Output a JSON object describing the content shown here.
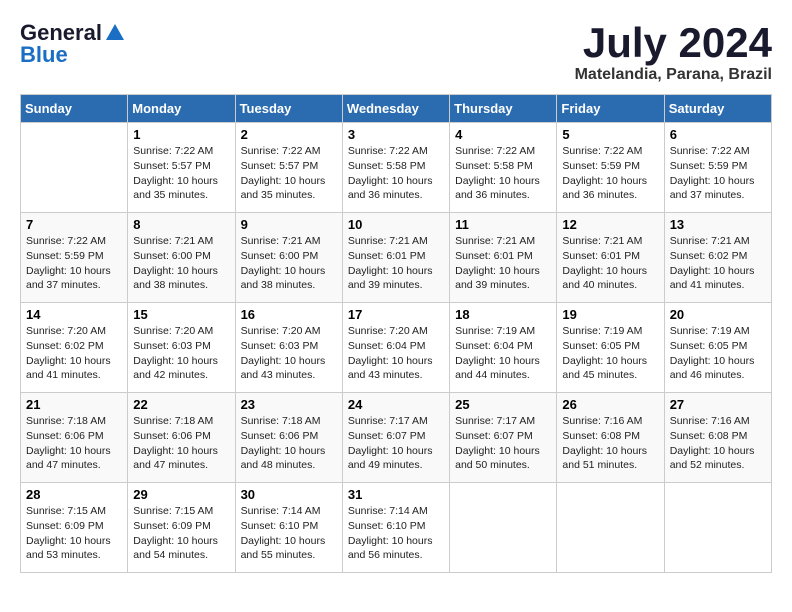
{
  "header": {
    "logo_general": "General",
    "logo_blue": "Blue",
    "month_title": "July 2024",
    "location": "Matelandia, Parana, Brazil"
  },
  "days_of_week": [
    "Sunday",
    "Monday",
    "Tuesday",
    "Wednesday",
    "Thursday",
    "Friday",
    "Saturday"
  ],
  "weeks": [
    [
      {
        "day": "",
        "sunrise": "",
        "sunset": "",
        "daylight": ""
      },
      {
        "day": "1",
        "sunrise": "Sunrise: 7:22 AM",
        "sunset": "Sunset: 5:57 PM",
        "daylight": "Daylight: 10 hours and 35 minutes."
      },
      {
        "day": "2",
        "sunrise": "Sunrise: 7:22 AM",
        "sunset": "Sunset: 5:57 PM",
        "daylight": "Daylight: 10 hours and 35 minutes."
      },
      {
        "day": "3",
        "sunrise": "Sunrise: 7:22 AM",
        "sunset": "Sunset: 5:58 PM",
        "daylight": "Daylight: 10 hours and 36 minutes."
      },
      {
        "day": "4",
        "sunrise": "Sunrise: 7:22 AM",
        "sunset": "Sunset: 5:58 PM",
        "daylight": "Daylight: 10 hours and 36 minutes."
      },
      {
        "day": "5",
        "sunrise": "Sunrise: 7:22 AM",
        "sunset": "Sunset: 5:59 PM",
        "daylight": "Daylight: 10 hours and 36 minutes."
      },
      {
        "day": "6",
        "sunrise": "Sunrise: 7:22 AM",
        "sunset": "Sunset: 5:59 PM",
        "daylight": "Daylight: 10 hours and 37 minutes."
      }
    ],
    [
      {
        "day": "7",
        "sunrise": "Sunrise: 7:22 AM",
        "sunset": "Sunset: 5:59 PM",
        "daylight": "Daylight: 10 hours and 37 minutes."
      },
      {
        "day": "8",
        "sunrise": "Sunrise: 7:21 AM",
        "sunset": "Sunset: 6:00 PM",
        "daylight": "Daylight: 10 hours and 38 minutes."
      },
      {
        "day": "9",
        "sunrise": "Sunrise: 7:21 AM",
        "sunset": "Sunset: 6:00 PM",
        "daylight": "Daylight: 10 hours and 38 minutes."
      },
      {
        "day": "10",
        "sunrise": "Sunrise: 7:21 AM",
        "sunset": "Sunset: 6:01 PM",
        "daylight": "Daylight: 10 hours and 39 minutes."
      },
      {
        "day": "11",
        "sunrise": "Sunrise: 7:21 AM",
        "sunset": "Sunset: 6:01 PM",
        "daylight": "Daylight: 10 hours and 39 minutes."
      },
      {
        "day": "12",
        "sunrise": "Sunrise: 7:21 AM",
        "sunset": "Sunset: 6:01 PM",
        "daylight": "Daylight: 10 hours and 40 minutes."
      },
      {
        "day": "13",
        "sunrise": "Sunrise: 7:21 AM",
        "sunset": "Sunset: 6:02 PM",
        "daylight": "Daylight: 10 hours and 41 minutes."
      }
    ],
    [
      {
        "day": "14",
        "sunrise": "Sunrise: 7:20 AM",
        "sunset": "Sunset: 6:02 PM",
        "daylight": "Daylight: 10 hours and 41 minutes."
      },
      {
        "day": "15",
        "sunrise": "Sunrise: 7:20 AM",
        "sunset": "Sunset: 6:03 PM",
        "daylight": "Daylight: 10 hours and 42 minutes."
      },
      {
        "day": "16",
        "sunrise": "Sunrise: 7:20 AM",
        "sunset": "Sunset: 6:03 PM",
        "daylight": "Daylight: 10 hours and 43 minutes."
      },
      {
        "day": "17",
        "sunrise": "Sunrise: 7:20 AM",
        "sunset": "Sunset: 6:04 PM",
        "daylight": "Daylight: 10 hours and 43 minutes."
      },
      {
        "day": "18",
        "sunrise": "Sunrise: 7:19 AM",
        "sunset": "Sunset: 6:04 PM",
        "daylight": "Daylight: 10 hours and 44 minutes."
      },
      {
        "day": "19",
        "sunrise": "Sunrise: 7:19 AM",
        "sunset": "Sunset: 6:05 PM",
        "daylight": "Daylight: 10 hours and 45 minutes."
      },
      {
        "day": "20",
        "sunrise": "Sunrise: 7:19 AM",
        "sunset": "Sunset: 6:05 PM",
        "daylight": "Daylight: 10 hours and 46 minutes."
      }
    ],
    [
      {
        "day": "21",
        "sunrise": "Sunrise: 7:18 AM",
        "sunset": "Sunset: 6:06 PM",
        "daylight": "Daylight: 10 hours and 47 minutes."
      },
      {
        "day": "22",
        "sunrise": "Sunrise: 7:18 AM",
        "sunset": "Sunset: 6:06 PM",
        "daylight": "Daylight: 10 hours and 47 minutes."
      },
      {
        "day": "23",
        "sunrise": "Sunrise: 7:18 AM",
        "sunset": "Sunset: 6:06 PM",
        "daylight": "Daylight: 10 hours and 48 minutes."
      },
      {
        "day": "24",
        "sunrise": "Sunrise: 7:17 AM",
        "sunset": "Sunset: 6:07 PM",
        "daylight": "Daylight: 10 hours and 49 minutes."
      },
      {
        "day": "25",
        "sunrise": "Sunrise: 7:17 AM",
        "sunset": "Sunset: 6:07 PM",
        "daylight": "Daylight: 10 hours and 50 minutes."
      },
      {
        "day": "26",
        "sunrise": "Sunrise: 7:16 AM",
        "sunset": "Sunset: 6:08 PM",
        "daylight": "Daylight: 10 hours and 51 minutes."
      },
      {
        "day": "27",
        "sunrise": "Sunrise: 7:16 AM",
        "sunset": "Sunset: 6:08 PM",
        "daylight": "Daylight: 10 hours and 52 minutes."
      }
    ],
    [
      {
        "day": "28",
        "sunrise": "Sunrise: 7:15 AM",
        "sunset": "Sunset: 6:09 PM",
        "daylight": "Daylight: 10 hours and 53 minutes."
      },
      {
        "day": "29",
        "sunrise": "Sunrise: 7:15 AM",
        "sunset": "Sunset: 6:09 PM",
        "daylight": "Daylight: 10 hours and 54 minutes."
      },
      {
        "day": "30",
        "sunrise": "Sunrise: 7:14 AM",
        "sunset": "Sunset: 6:10 PM",
        "daylight": "Daylight: 10 hours and 55 minutes."
      },
      {
        "day": "31",
        "sunrise": "Sunrise: 7:14 AM",
        "sunset": "Sunset: 6:10 PM",
        "daylight": "Daylight: 10 hours and 56 minutes."
      },
      {
        "day": "",
        "sunrise": "",
        "sunset": "",
        "daylight": ""
      },
      {
        "day": "",
        "sunrise": "",
        "sunset": "",
        "daylight": ""
      },
      {
        "day": "",
        "sunrise": "",
        "sunset": "",
        "daylight": ""
      }
    ]
  ]
}
